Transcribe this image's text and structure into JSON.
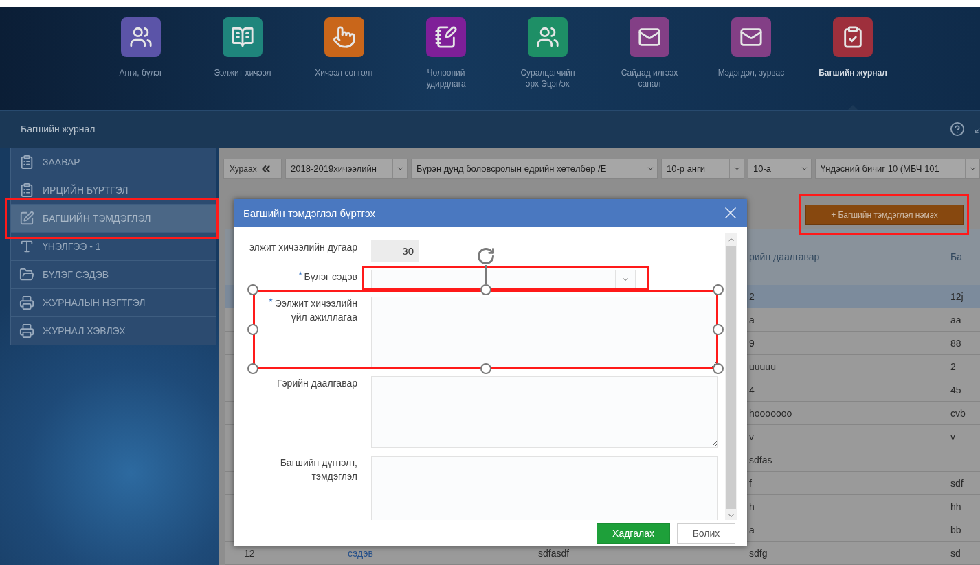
{
  "nav": {
    "items": [
      {
        "label": "Анги, бүлэг",
        "color": "#5b54a8",
        "selected": false
      },
      {
        "label": "Ээлжит хичээл",
        "color": "#1f857c",
        "selected": false
      },
      {
        "label": "Хичээл сонголт",
        "color": "#c9661a",
        "selected": false
      },
      {
        "label": "Чөлөөний\nудирдлага",
        "color": "#7f1f98",
        "selected": false
      },
      {
        "label": "Суралцагчийн\nэрх Эцэг/эх",
        "color": "#1e8f66",
        "selected": false
      },
      {
        "label": "Сайдад илгээх\nсанал",
        "color": "#833f86",
        "selected": false
      },
      {
        "label": "Мэдэгдэл, зурвас",
        "color": "#833f86",
        "selected": false
      },
      {
        "label": "Багшийн журнал",
        "color": "#9e2f3c",
        "selected": true
      }
    ]
  },
  "header": {
    "title": "Багшийн журнал"
  },
  "sidebar": {
    "items": [
      {
        "label": "ЗААВАР",
        "selected": false,
        "annotated": false
      },
      {
        "label": "ИРЦИЙН БҮРТГЭЛ",
        "selected": false,
        "annotated": false
      },
      {
        "label": "БАГШИЙН ТЭМДЭГЛЭЛ",
        "selected": true,
        "annotated": true
      },
      {
        "label": "ҮНЭЛГЭЭ - 1",
        "selected": false,
        "annotated": false
      },
      {
        "label": "БҮЛЭГ СЭДЭВ",
        "selected": false,
        "annotated": false
      },
      {
        "label": "ЖУРНАЛЫН НЭГТГЭЛ",
        "selected": false,
        "annotated": false
      },
      {
        "label": "ЖУРНАЛ ХЭВЛЭХ",
        "selected": false,
        "annotated": false
      }
    ]
  },
  "filters": {
    "collapse_label": "Хураах",
    "selects": [
      "2018-2019хичээлийн",
      "Бүрэн дунд боловсролын өдрийн хөтөлбөр /Е",
      "10-р анги",
      "10-а",
      "Үндэсний бичиг 10 (МБЧ 101"
    ]
  },
  "content": {
    "add_button": {
      "label": "+ Багшийн тэмдэглэл нэмэх",
      "annotated": true
    },
    "table": {
      "columns": {
        "column_4": "рийн даалгавар",
        "column_5": "Ба"
      },
      "rows": [
        {
          "column_4": "2",
          "column_5": "12j",
          "selected": true
        },
        {
          "column_4": "a",
          "column_5": "aa",
          "selected": false
        },
        {
          "column_4": "9",
          "column_5": "88",
          "selected": false
        },
        {
          "column_4": "uuuuu",
          "column_5": "2",
          "selected": false
        },
        {
          "column_4": "4",
          "column_5": "45",
          "selected": false
        },
        {
          "column_4": "hooooooo",
          "column_5": "cvb",
          "selected": false
        },
        {
          "column_4": "v",
          "column_5": "v",
          "selected": false
        },
        {
          "column_4": "sdfas",
          "selected": false
        },
        {
          "column_4": "f",
          "column_5": "sdf",
          "selected": false
        },
        {
          "column_4": "h",
          "column_5": "hh",
          "selected": false
        },
        {
          "column_4": "a",
          "column_5": "bb",
          "selected": false
        },
        {
          "number": "12",
          "column_2": "сэдэв",
          "column_3": "sdfasdf",
          "column_4": "sdfg",
          "column_5": "sd",
          "selected": false
        }
      ]
    }
  },
  "modal": {
    "title": "Багшийн тэмдэглэл бүртгэх",
    "fields": [
      {
        "kind": "number",
        "label": "элжит хичээлийн дугаар",
        "value": "30",
        "required": false,
        "annotated": false
      },
      {
        "kind": "select",
        "label": "Бүлэг сэдэв",
        "required": true,
        "annotated": true
      },
      {
        "kind": "textarea",
        "label": "Ээлжит хичээлийн\nүйл ажиллагаа",
        "required": true,
        "annotated": true
      },
      {
        "kind": "textarea",
        "label": "Гэрийн даалгавар",
        "required": false,
        "annotated": false
      },
      {
        "kind": "textarea",
        "label": "Багшийн дүгнэлт,\nтэмдэглэл",
        "required": false,
        "annotated": false
      }
    ],
    "buttons": [
      {
        "kind": "primary",
        "label": "Хадгалах"
      },
      {
        "kind": "secondary",
        "label": "Болих"
      }
    ]
  }
}
